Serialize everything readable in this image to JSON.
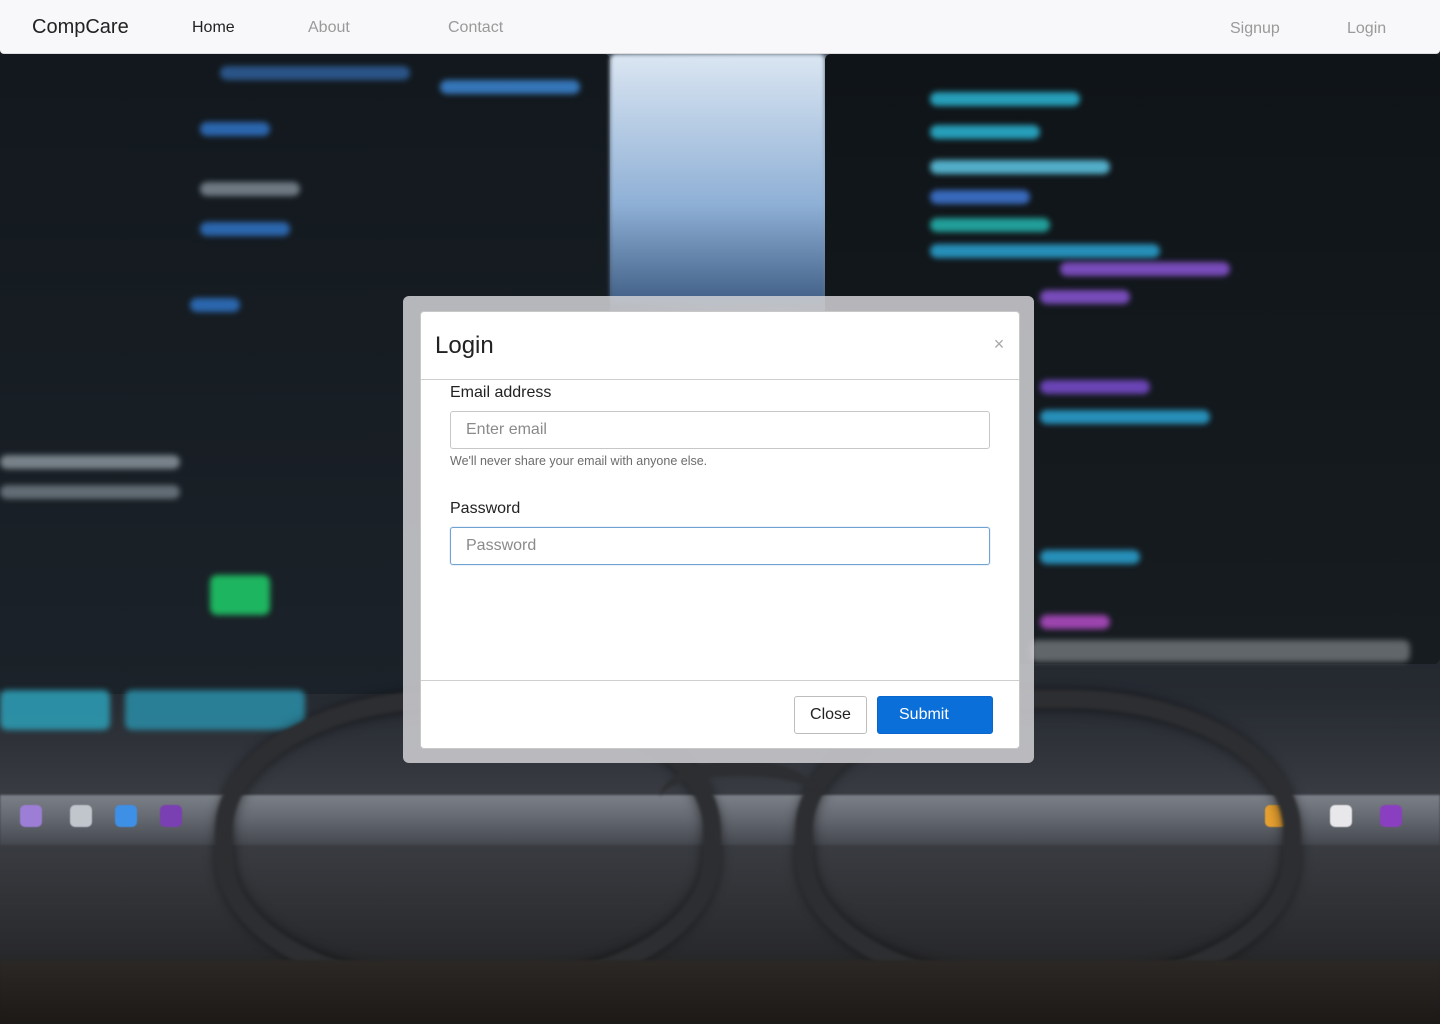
{
  "navbar": {
    "brand": "CompCare",
    "links": {
      "home": "Home",
      "about": "About",
      "contact": "Contact",
      "signup": "Signup",
      "login": "Login"
    },
    "active": "home"
  },
  "modal": {
    "title": "Login",
    "close_glyph": "×",
    "email": {
      "label": "Email address",
      "placeholder": "Enter email",
      "value": "",
      "help": "We'll never share your email with anyone else."
    },
    "password": {
      "label": "Password",
      "placeholder": "Password",
      "value": "",
      "focused": true
    },
    "buttons": {
      "close": "Close",
      "submit": "Submit"
    }
  },
  "colors": {
    "primary": "#0a6fd8",
    "navbar_bg": "#f8f8fa",
    "nav_active": "#222222",
    "nav_inactive": "#9a9a9a",
    "focus_border": "#6fa3d4"
  },
  "background": {
    "description_icon": "blurred-monitor-code-with-glasses-photo"
  }
}
